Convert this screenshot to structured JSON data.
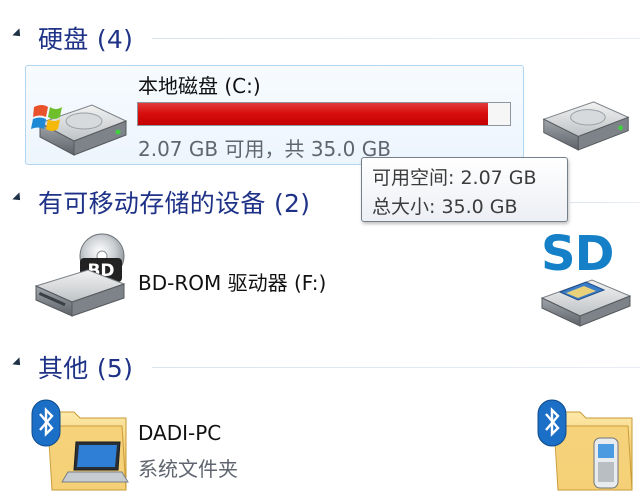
{
  "groups": {
    "hard_disks": {
      "title": "硬盘 (4)"
    },
    "removable": {
      "title": "有可移动存储的设备 (2)"
    },
    "other": {
      "title": "其他 (5)"
    }
  },
  "items": {
    "local_disk_c": {
      "name": "本地磁盘 (C:)",
      "space_text": "2.07 GB 可用，共 35.0 GB",
      "used_fraction": 0.941,
      "bar_color": "#d40000"
    },
    "bd_rom": {
      "name": "BD-ROM 驱动器 (F:)",
      "disc_badge": "BD"
    },
    "sd_card": {
      "logo": "SD"
    },
    "dadi_pc": {
      "name": "DADI-PC",
      "type": "系统文件夹"
    }
  },
  "tooltip": {
    "line1": "可用空间: 2.07 GB",
    "line2": "总大小: 35.0 GB"
  },
  "icons": {
    "hard_disk": "hard-drive-icon",
    "windows_drive": "windows-drive-icon",
    "bd_drive": "bd-rom-drive-icon",
    "sd_card": "sd-card-reader-icon",
    "bluetooth": "bluetooth-icon",
    "folder": "folder-icon",
    "laptop": "laptop-icon",
    "phone": "phone-icon"
  }
}
